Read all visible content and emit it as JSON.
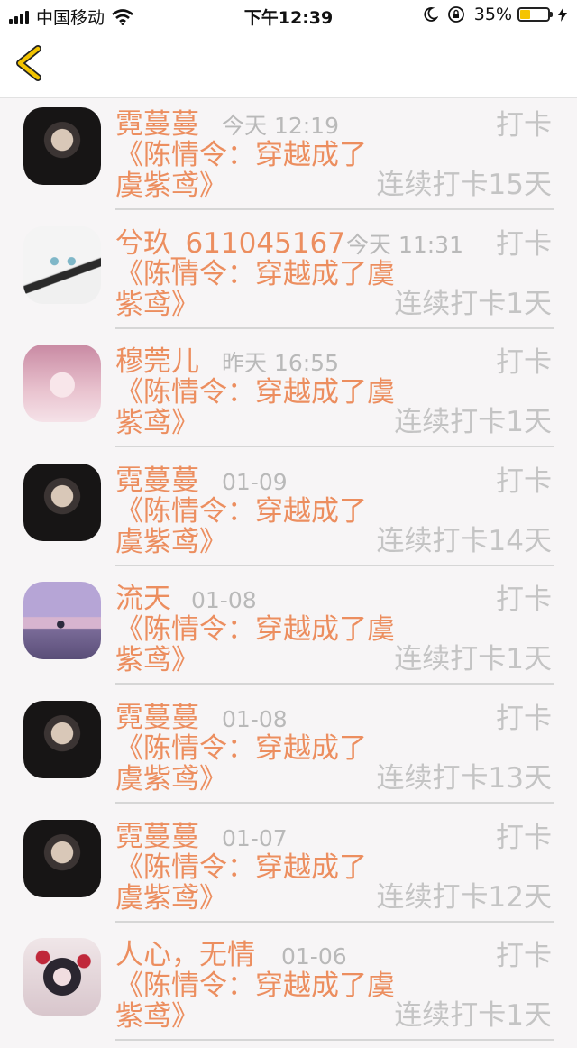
{
  "status_bar": {
    "carrier": "中国移动",
    "time": "下午12:39",
    "battery_percent": "35%",
    "battery_level": 0.35,
    "battery_color": "#f5c400"
  },
  "nav": {
    "back_icon": "chevron-left-icon",
    "accent": "#f2c300"
  },
  "theme": {
    "name_color": "#ec8e5f",
    "meta_color": "#b9b9b9"
  },
  "checkins": [
    {
      "name": "霓蔓蔓",
      "date": "今天 12:19",
      "label": "打卡",
      "title": "《陈情令：穿越成了虞紫鸢》",
      "streak": "连续打卡15天"
    },
    {
      "name": "兮玖_611045167",
      "date": "今天 11:31",
      "label": "打卡",
      "title": "《陈情令：穿越成了虞紫鸢》",
      "streak": "连续打卡1天"
    },
    {
      "name": "穆莞儿",
      "date": "昨天 16:55",
      "label": "打卡",
      "title": "《陈情令：穿越成了虞紫鸢》",
      "streak": "连续打卡1天"
    },
    {
      "name": "霓蔓蔓",
      "date": "01-09",
      "label": "打卡",
      "title": "《陈情令：穿越成了虞紫鸢》",
      "streak": "连续打卡14天"
    },
    {
      "name": "流天",
      "date": "01-08",
      "label": "打卡",
      "title": "《陈情令：穿越成了虞紫鸢》",
      "streak": "连续打卡1天"
    },
    {
      "name": "霓蔓蔓",
      "date": "01-08",
      "label": "打卡",
      "title": "《陈情令：穿越成了虞紫鸢》",
      "streak": "连续打卡13天"
    },
    {
      "name": "霓蔓蔓",
      "date": "01-07",
      "label": "打卡",
      "title": "《陈情令：穿越成了虞紫鸢》",
      "streak": "连续打卡12天"
    },
    {
      "name": "人心，无情",
      "date": "01-06",
      "label": "打卡",
      "title": "《陈情令：穿越成了虞紫鸢》",
      "streak": "连续打卡1天"
    }
  ]
}
